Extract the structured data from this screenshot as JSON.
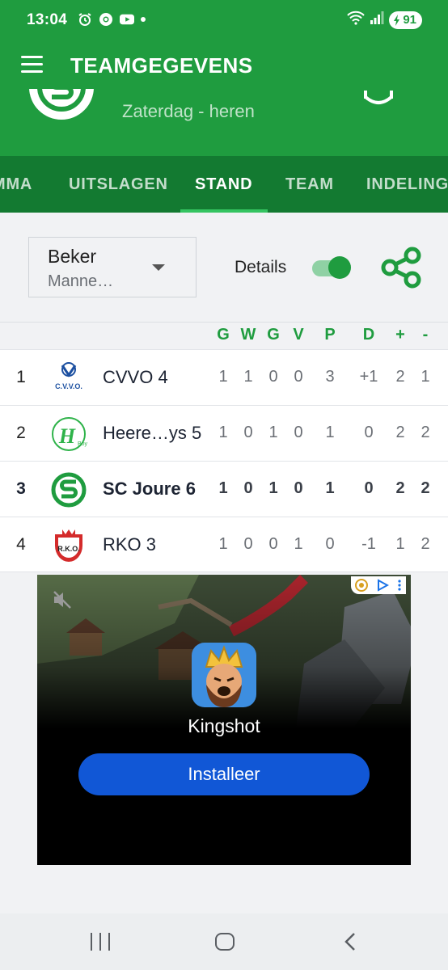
{
  "status": {
    "time": "13:04",
    "battery": "91"
  },
  "appbar": {
    "title": "TEAMGEGEVENS"
  },
  "team": {
    "subtitle": "Zaterdag - heren"
  },
  "tabs": [
    {
      "label": "MMA"
    },
    {
      "label": "UITSLAGEN"
    },
    {
      "label": "STAND"
    },
    {
      "label": "TEAM"
    },
    {
      "label": "INDELING"
    }
  ],
  "filter": {
    "competition": "Beker",
    "category": "Manne…",
    "details_label": "Details",
    "details_on": true
  },
  "table": {
    "headers": [
      "G",
      "W",
      "G",
      "V",
      "P",
      "D",
      "+",
      "-"
    ],
    "rows": [
      {
        "rank": "1",
        "club": "CVVO 4",
        "logo": "cvvo-logo",
        "stats": [
          "1",
          "1",
          "0",
          "0",
          "3",
          "+1",
          "2",
          "1"
        ]
      },
      {
        "rank": "2",
        "club": "Heere…ys 5",
        "logo": "heerenveense-boys-logo",
        "stats": [
          "1",
          "0",
          "1",
          "0",
          "1",
          "0",
          "2",
          "2"
        ]
      },
      {
        "rank": "3",
        "club": "SC Joure 6",
        "logo": "sc-joure-logo",
        "stats": [
          "1",
          "0",
          "1",
          "0",
          "1",
          "0",
          "2",
          "2"
        ],
        "highlight": true
      },
      {
        "rank": "4",
        "club": "RKO 3",
        "logo": "rko-logo",
        "stats": [
          "1",
          "0",
          "0",
          "1",
          "0",
          "-1",
          "1",
          "2"
        ]
      }
    ]
  },
  "ad": {
    "app_name": "Kingshot",
    "install_label": "Installeer"
  },
  "colors": {
    "primary": "#1f9c3f",
    "tabs": "#137a31",
    "install": "#1157d6"
  }
}
